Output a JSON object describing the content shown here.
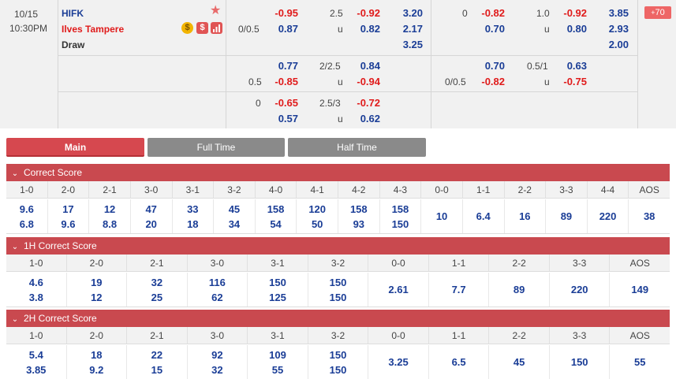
{
  "match": {
    "date": "10/15",
    "time": "10:30PM",
    "home_team": "HIFK",
    "away_team": "Ilves Tampere",
    "draw_label": "Draw",
    "more_count": "70",
    "icons": [
      "star-icon",
      "coin-icon",
      "dollar-icon",
      "chart-icon"
    ]
  },
  "full_time": {
    "handicap": [
      {
        "line_top": "",
        "line_bottom": "0/0.5",
        "odds_top": "-0.95",
        "odds_bottom": "0.87"
      },
      {
        "line_top": "",
        "line_bottom": "0.5",
        "odds_top": "0.77",
        "odds_bottom": "-0.85"
      },
      {
        "line_top": "",
        "line_bottom": "0",
        "odds_top": "-0.65",
        "odds_bottom": "0.57"
      }
    ],
    "over_under": [
      {
        "line": "2.5",
        "under_label": "u",
        "odds_top": "-0.92",
        "odds_bottom": "0.82"
      },
      {
        "line": "2/2.5",
        "under_label": "u",
        "odds_top": "0.84",
        "odds_bottom": "-0.94"
      },
      {
        "line": "2.5/3",
        "under_label": "u",
        "odds_top": "-0.72",
        "odds_bottom": "0.62"
      }
    ],
    "one_x_two": [
      "3.20",
      "2.17",
      "3.25"
    ]
  },
  "half_time": {
    "handicap": [
      {
        "line_top": "0",
        "line_bottom": "",
        "odds_top": "-0.82",
        "odds_bottom": "0.70"
      },
      {
        "line_top": "",
        "line_bottom": "0/0.5",
        "odds_top": "0.70",
        "odds_bottom": "-0.82"
      }
    ],
    "over_under": [
      {
        "line": "1.0",
        "under_label": "u",
        "odds_top": "-0.92",
        "odds_bottom": "0.80"
      },
      {
        "line": "0.5/1",
        "under_label": "u",
        "odds_top": "0.63",
        "odds_bottom": "-0.75"
      }
    ],
    "one_x_two": [
      "3.85",
      "2.93",
      "2.00"
    ]
  },
  "tabs": [
    "Main",
    "Full Time",
    "Half Time"
  ],
  "sections": [
    {
      "title": "Correct Score",
      "headers": [
        "1-0",
        "2-0",
        "2-1",
        "3-0",
        "3-1",
        "3-2",
        "4-0",
        "4-1",
        "4-2",
        "4-3",
        "0-0",
        "1-1",
        "2-2",
        "3-3",
        "4-4",
        "AOS"
      ],
      "values": [
        [
          "9.6",
          "6.8"
        ],
        [
          "17",
          "9.6"
        ],
        [
          "12",
          "8.8"
        ],
        [
          "47",
          "20"
        ],
        [
          "33",
          "18"
        ],
        [
          "45",
          "34"
        ],
        [
          "158",
          "54"
        ],
        [
          "120",
          "50"
        ],
        [
          "158",
          "93"
        ],
        [
          "158",
          "150"
        ],
        [
          "10"
        ],
        [
          "6.4"
        ],
        [
          "16"
        ],
        [
          "89"
        ],
        [
          "220"
        ],
        [
          "38"
        ]
      ]
    },
    {
      "title": "1H Correct Score",
      "headers": [
        "1-0",
        "2-0",
        "2-1",
        "3-0",
        "3-1",
        "3-2",
        "0-0",
        "1-1",
        "2-2",
        "3-3",
        "AOS"
      ],
      "values": [
        [
          "4.6",
          "3.8"
        ],
        [
          "19",
          "12"
        ],
        [
          "32",
          "25"
        ],
        [
          "116",
          "62"
        ],
        [
          "150",
          "125"
        ],
        [
          "150",
          "150"
        ],
        [
          "2.61"
        ],
        [
          "7.7"
        ],
        [
          "89"
        ],
        [
          "220"
        ],
        [
          "149"
        ]
      ]
    },
    {
      "title": "2H Correct Score",
      "headers": [
        "1-0",
        "2-0",
        "2-1",
        "3-0",
        "3-1",
        "3-2",
        "0-0",
        "1-1",
        "2-2",
        "3-3",
        "AOS"
      ],
      "values": [
        [
          "5.4",
          "3.85"
        ],
        [
          "18",
          "9.2"
        ],
        [
          "22",
          "15"
        ],
        [
          "92",
          "32"
        ],
        [
          "109",
          "55"
        ],
        [
          "150",
          "150"
        ],
        [
          "3.25"
        ],
        [
          "6.5"
        ],
        [
          "45"
        ],
        [
          "150"
        ],
        [
          "55"
        ]
      ]
    }
  ]
}
